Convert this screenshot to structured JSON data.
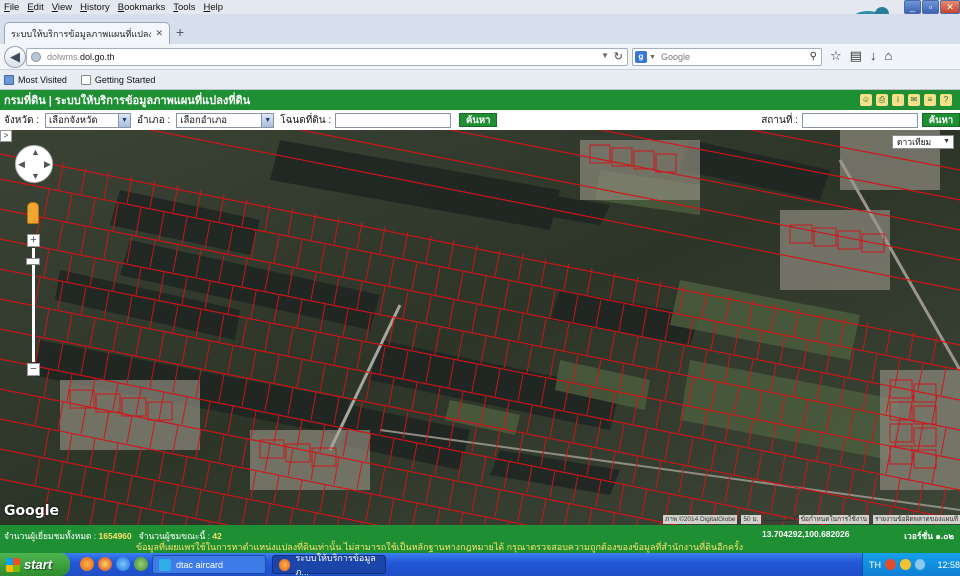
{
  "browser": {
    "menu": [
      "File",
      "Edit",
      "View",
      "History",
      "Bookmarks",
      "Tools",
      "Help"
    ],
    "tab_title": "ระบบให้บริการข้อมูลภาพแผนที่แปลงที่ดิ...",
    "url_prefix": "dolwms.",
    "url_host": "dol.go.th",
    "search_engine": "Google",
    "search_placeholder": "Google",
    "bookmarks": [
      "Most Visited",
      "Getting Started"
    ]
  },
  "site": {
    "title": "กรมที่ดิน | ระบบให้บริการข้อมูลภาพแผนที่แปลงที่ดิน",
    "province_label": "จังหวัด :",
    "province_value": "เลือกจังหวัด",
    "district_label": "อำเภอ :",
    "district_value": "เลือกอำเภอ",
    "deed_label": "โฉนดที่ดิน :",
    "search_button": "ค้นหา",
    "place_label": "สถานที่ :",
    "place_search_button": "ค้นหา"
  },
  "map": {
    "map_type": "ดาวเทียม",
    "attribution": "ภาพ ©2014 DigitalGlobe",
    "scale": "50 ม.",
    "terms": "ข้อกำหนดในการใช้งาน",
    "report": "รายงานข้อผิดพลาดของแผนที่",
    "google_logo": "Google"
  },
  "footer": {
    "total_visitors_label": "จำนวนผู้เยี่ยมชมทั้งหมด :",
    "total_visitors": "1654960",
    "online_label": "จำนวนผู้ชมขณะนี้ :",
    "online": "42",
    "coords": "13.704292,100.682026",
    "version": "เวอร์ชั่น ๑.๐๒",
    "disclaimer": "ข้อมูลที่เผยแพร่ใช้ในการหาตำแหน่งแปลงที่ดินเท่านั้น ไม่สามารถใช้เป็นหลักฐานทางกฎหมายได้ กรุณาตรวจสอบความถูกต้องของข้อมูลที่สำนักงานที่ดินอีกครั้ง"
  },
  "taskbar": {
    "start": "start",
    "task1": "dtac aircard",
    "task2": "ระบบให้บริการข้อมูลภ...",
    "lang": "TH",
    "clock": "12:58"
  }
}
